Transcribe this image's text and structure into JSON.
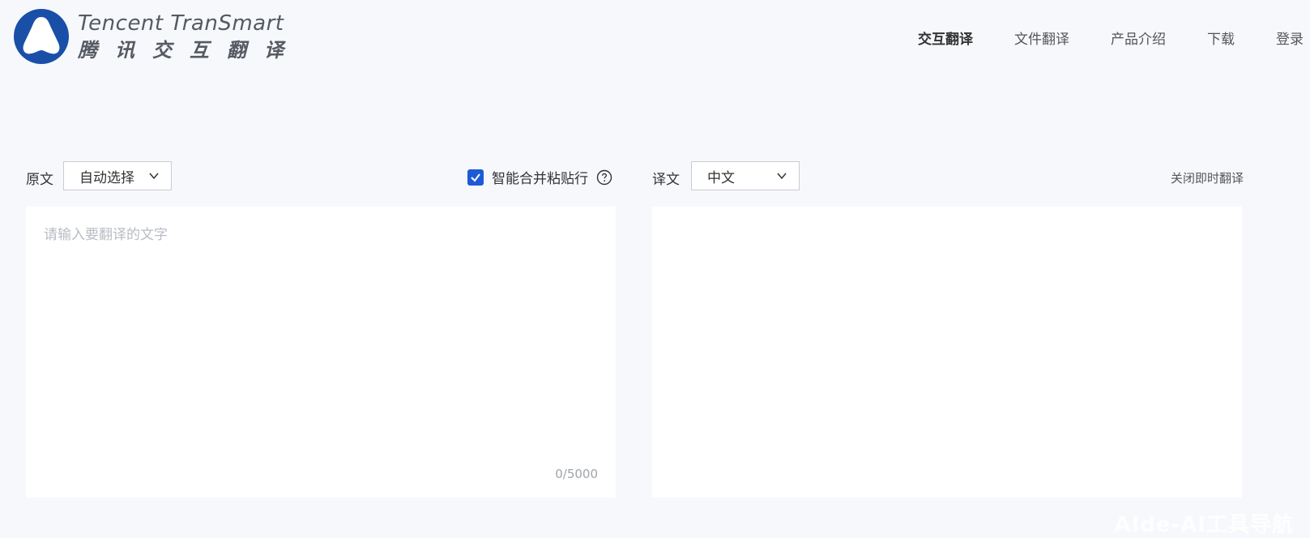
{
  "brand": {
    "name_en": "Tencent TranSmart",
    "name_cn": "腾讯交互翻译",
    "primary_color": "#1a4fa8"
  },
  "nav": {
    "items": [
      {
        "label": "交互翻译",
        "active": true
      },
      {
        "label": "文件翻译",
        "active": false
      },
      {
        "label": "产品介绍",
        "active": false
      },
      {
        "label": "下载",
        "active": false
      },
      {
        "label": "登录",
        "active": false
      }
    ]
  },
  "source": {
    "label": "原文",
    "language_selected": "自动选择",
    "placeholder": "请输入要翻译的文字",
    "value": "",
    "char_count": "0/5000"
  },
  "options": {
    "smart_merge_label": "智能合并粘贴行",
    "smart_merge_checked": true,
    "checkbox_color": "#1d5bd6"
  },
  "target": {
    "label": "译文",
    "language_selected": "中文",
    "output": "",
    "instant_toggle_label": "关闭即时翻译"
  },
  "watermark": {
    "text": "AIde-AI工具导航"
  },
  "icons": {
    "logo": "tencent-transmart-logo-icon",
    "dropdown": "chevron-down-icon",
    "check": "check-icon",
    "help": "question-circle-icon"
  }
}
